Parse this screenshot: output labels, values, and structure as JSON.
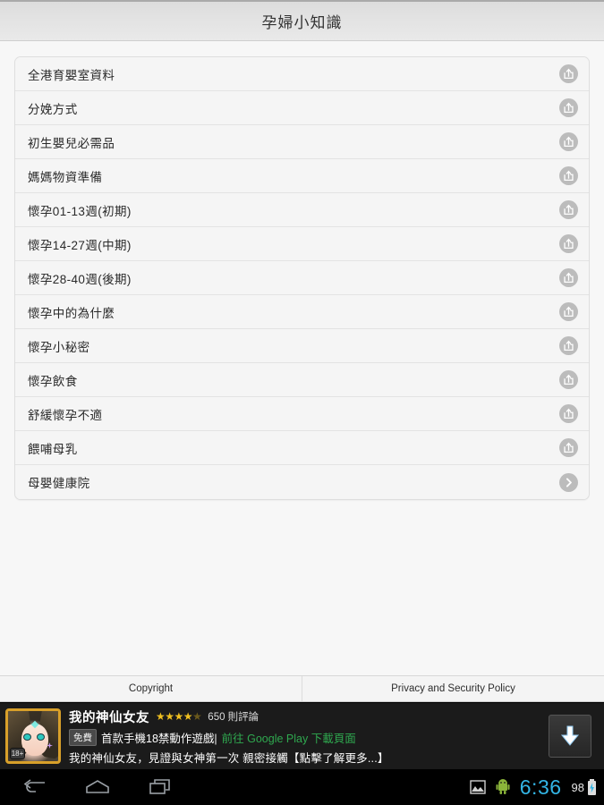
{
  "header": {
    "title": "孕婦小知識"
  },
  "list": {
    "items": [
      {
        "label": "全港育嬰室資料",
        "icon": "share-icon"
      },
      {
        "label": "分娩方式",
        "icon": "share-icon"
      },
      {
        "label": "初生嬰兒必需品",
        "icon": "share-icon"
      },
      {
        "label": "媽媽物資準備",
        "icon": "share-icon"
      },
      {
        "label": "懷孕01-13週(初期)",
        "icon": "share-icon"
      },
      {
        "label": "懷孕14-27週(中期)",
        "icon": "share-icon"
      },
      {
        "label": "懷孕28-40週(後期)",
        "icon": "share-icon"
      },
      {
        "label": "懷孕中的為什麼",
        "icon": "share-icon"
      },
      {
        "label": "懷孕小秘密",
        "icon": "share-icon"
      },
      {
        "label": "懷孕飲食",
        "icon": "share-icon"
      },
      {
        "label": "舒緩懷孕不適",
        "icon": "share-icon"
      },
      {
        "label": "餵哺母乳",
        "icon": "share-icon"
      },
      {
        "label": "母嬰健康院",
        "icon": "chevron-right-icon"
      }
    ]
  },
  "footer": {
    "copyright_label": "Copyright",
    "privacy_label": "Privacy and Security Policy"
  },
  "ad": {
    "title": "我的神仙女友",
    "stars": "★★★★",
    "half_star": "★",
    "reviews": "650 則評論",
    "free_badge": "免費",
    "subtitle": "首款手機18禁動作遊戲|",
    "link_text": "前往 Google Play 下載頁面",
    "description": "我的神仙女友，見證與女神第一次 親密接觸【點擊了解更多...】",
    "age_badge": "18+",
    "download_icon": "download-arrow-icon"
  },
  "statusbar": {
    "time": "6:36",
    "battery_level": "98"
  },
  "colors": {
    "accent_blue": "#33b5e5",
    "link_green": "#2fa84f",
    "star_gold": "#f0c020",
    "page_bg": "#f7f7f7"
  }
}
